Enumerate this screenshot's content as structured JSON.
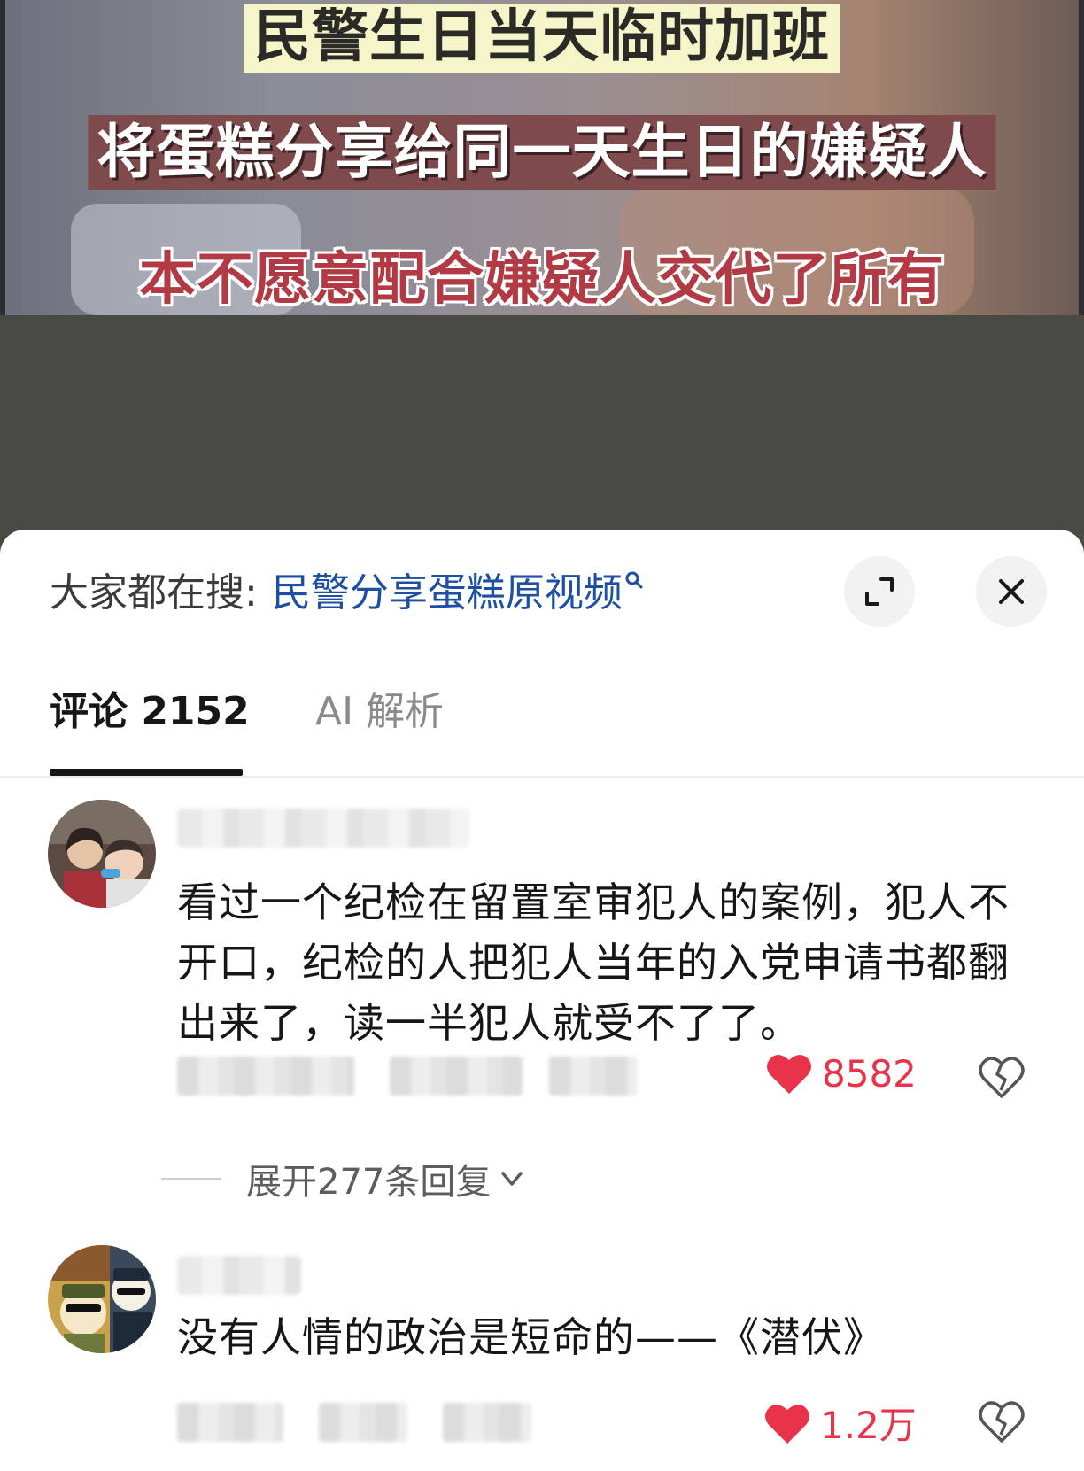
{
  "video": {
    "caption_line1": "民警生日当天临时加班",
    "caption_line2": "将蛋糕分享给同一天生日的嫌疑人",
    "caption_line3": "本不愿意配合嫌疑人交代了所有"
  },
  "sheet": {
    "search_label": "大家都在搜:",
    "search_term": "民警分享蛋糕原视频",
    "expand_icon": "expand-icon",
    "close_icon": "close-icon"
  },
  "tabs": [
    {
      "label": "评论 2152",
      "active": true
    },
    {
      "label": "AI 解析",
      "active": false
    }
  ],
  "comments": [
    {
      "avatar": "avatar-photo-children",
      "text": "看过一个纪检在留置室审犯人的案例，犯人不开口，纪检的人把犯人当年的入党申请书都翻出来了，读一半犯人就受不了了。",
      "likes": "8582",
      "liked": true,
      "replies_label": "展开277条回复"
    },
    {
      "avatar": "avatar-cartoon-characters",
      "text": "没有人情的政治是短命的——《潜伏》",
      "likes": "1.2万",
      "liked": true
    }
  ],
  "colors": {
    "accent_link": "#1d4fa2",
    "like_red": "#e8334a",
    "text_primary": "#161616",
    "sheet_background": "#ffffff",
    "backdrop": "#4a4a45"
  }
}
